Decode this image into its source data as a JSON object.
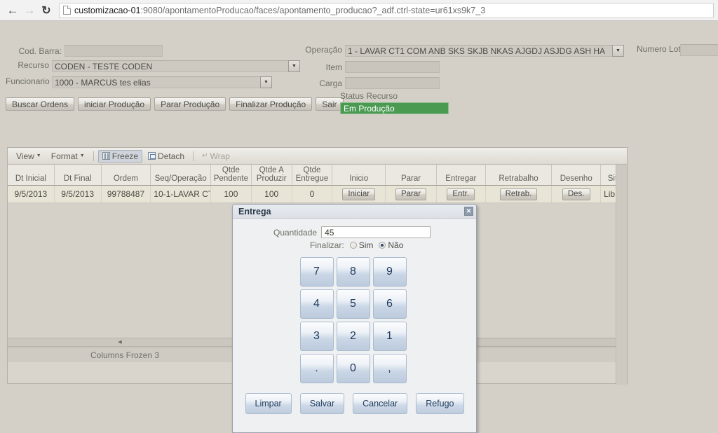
{
  "browser": {
    "back_icon": "arrow-left-icon",
    "forward_icon": "arrow-right-icon",
    "reload_icon": "reload-icon",
    "page_icon": "page-icon",
    "url_host": "customizacao-01",
    "url_rest": ":9080/apontamentoProducao/faces/apontamento_producao?_adf.ctrl-state=ur61xs9k7_3"
  },
  "form": {
    "cod_barra": {
      "label": "Cod. Barra:",
      "value": ""
    },
    "recurso": {
      "label": "Recurso",
      "value": "CODEN - TESTE CODEN"
    },
    "funcionario": {
      "label": "Funcionario",
      "value": "1000 - MARCUS tes elias"
    },
    "operacao": {
      "label": "Operação",
      "value": "1 - LAVAR CT1 COM ANB SKS SKJB NKAS AJGDJ ASJDG ASH HA"
    },
    "item": {
      "label": "Item",
      "value": ""
    },
    "carga": {
      "label": "Carga",
      "value": ""
    },
    "numero_lote": {
      "label": "Numero Lote",
      "value": ""
    },
    "buttons": [
      "Buscar Ordens",
      "iniciar Produção",
      "Parar Produção",
      "Finalizar Produção",
      "Sair"
    ],
    "status": {
      "label": "Status Recurso",
      "value": "Em Produção",
      "color": "#4a9a52"
    }
  },
  "table": {
    "toolbar": {
      "view": "View",
      "format": "Format",
      "freeze": "Freeze",
      "detach": "Detach",
      "wrap": "Wrap",
      "freeze_icon": "freeze-columns-icon",
      "detach_icon": "detach-icon",
      "wrap_icon": "wrap-text-icon"
    },
    "columns": [
      {
        "label": "Dt Inicial",
        "width": 67
      },
      {
        "label": "Dt Final",
        "width": 67
      },
      {
        "label": "Ordem",
        "width": 71
      },
      {
        "label": "Seq/Operação",
        "width": 86
      },
      {
        "label": "Qtde Pendente",
        "width": 58
      },
      {
        "label": "Qtde A Produzir",
        "width": 58
      },
      {
        "label": "Qtde Entregue",
        "width": 58
      },
      {
        "label": "Inicio",
        "width": 76
      },
      {
        "label": "Parar",
        "width": 73
      },
      {
        "label": "Entregar",
        "width": 70
      },
      {
        "label": "Retrabalho",
        "width": 95
      },
      {
        "label": "Desenho",
        "width": 70
      },
      {
        "label": "Sit.",
        "width": 37
      }
    ],
    "rows": [
      {
        "dt_inicial": "9/5/2013",
        "dt_final": "9/5/2013",
        "ordem": "99788487",
        "seq_operacao": "10-1-LAVAR CT",
        "qtde_pendente": "100",
        "qtde_a_produzir": "100",
        "qtde_entregue": "0",
        "inicio_btn": "Iniciar",
        "parar_btn": "Parar",
        "entregar_btn": "Entr.",
        "retrabalho_btn": "Retrab.",
        "desenho_btn": "Des.",
        "sit": "Lib"
      }
    ],
    "status_text": "Columns Frozen 3",
    "scroll_left_icon": "scroll-left-arrow-icon",
    "scroll_right_icon": "scroll-right-arrow-icon"
  },
  "dialog": {
    "title": "Entrega",
    "close_icon": "close-icon",
    "quantidade": {
      "label": "Quantidade",
      "value": "45"
    },
    "finalizar": {
      "label": "Finalizar:",
      "options": [
        {
          "label": "Sim",
          "selected": false
        },
        {
          "label": "Não",
          "selected": true
        }
      ]
    },
    "keypad": [
      "7",
      "8",
      "9",
      "4",
      "5",
      "6",
      "3",
      "2",
      "1",
      ".",
      "0",
      ","
    ],
    "actions": [
      "Limpar",
      "Salvar",
      "Cancelar",
      "Refugo"
    ]
  }
}
